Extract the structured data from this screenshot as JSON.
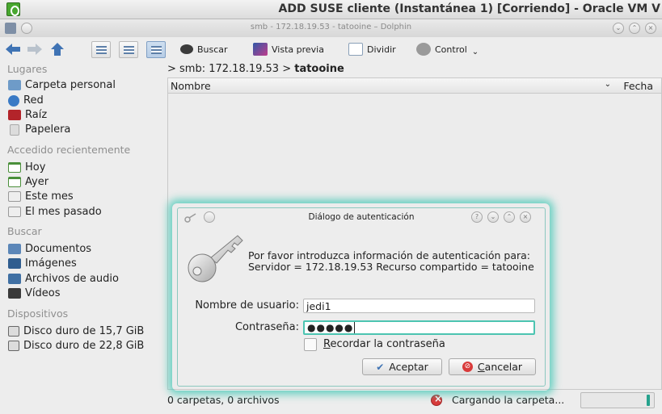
{
  "vbox": {
    "title": "ADD SUSE cliente (Instantánea 1) [Corriendo] - Oracle VM V"
  },
  "dolphin": {
    "title": "smb - 172.18.19.53 - tatooine – Dolphin",
    "toolbar": {
      "search": "Buscar",
      "preview": "Vista previa",
      "split": "Dividir",
      "control": "Control"
    },
    "breadcrumb": {
      "prefix": "> smb: 172.18.19.53 >",
      "current": "tatooine"
    },
    "columns": {
      "name": "Nombre",
      "date": "Fecha"
    },
    "status": {
      "summary": "0 carpetas, 0 archivos",
      "loading": "Cargando la carpeta..."
    }
  },
  "sidebar": {
    "sections": {
      "places": "Lugares",
      "recent": "Accedido recientemente",
      "search": "Buscar",
      "devices": "Dispositivos"
    },
    "places": [
      {
        "label": "Carpeta personal",
        "icon": "home-folder-icon",
        "color": "#6e9bc8"
      },
      {
        "label": "Red",
        "icon": "network-icon",
        "color": "#3a7ac5"
      },
      {
        "label": "Raíz",
        "icon": "root-folder-icon",
        "color": "#b3242a"
      },
      {
        "label": "Papelera",
        "icon": "trash-icon",
        "color": "#cfcfcf"
      }
    ],
    "recent": [
      {
        "label": "Hoy",
        "icon": "calendar-today-icon"
      },
      {
        "label": "Ayer",
        "icon": "calendar-yesterday-icon"
      },
      {
        "label": "Este mes",
        "icon": "calendar-month-icon"
      },
      {
        "label": "El mes pasado",
        "icon": "calendar-last-month-icon"
      }
    ],
    "search": [
      {
        "label": "Documentos",
        "icon": "documents-icon"
      },
      {
        "label": "Imágenes",
        "icon": "images-icon"
      },
      {
        "label": "Archivos de audio",
        "icon": "audio-icon"
      },
      {
        "label": "Vídeos",
        "icon": "videos-icon"
      }
    ],
    "devices": [
      {
        "label": "Disco duro de 15,7 GiB",
        "icon": "hard-drive-icon"
      },
      {
        "label": "Disco duro de 22,8 GiB",
        "icon": "hard-drive-icon"
      }
    ]
  },
  "dialog": {
    "title": "Diálogo de autenticación",
    "message": "Por favor introduzca información de autenticación para: Servidor = 172.18.19.53 Recurso compartido = tatooine",
    "username_label": "Nombre de usuario:",
    "username_value": "jedi1",
    "password_label": "Contraseña:",
    "password_mask": "●●●●●",
    "remember_pre": "",
    "remember_accel": "R",
    "remember_post": "ecordar la contraseña",
    "ok_label": "Aceptar",
    "cancel_accel": "C",
    "cancel_post": "ancelar",
    "accent": "#4cc4b1"
  },
  "loading": {
    "progress_fraction": 0.05
  }
}
